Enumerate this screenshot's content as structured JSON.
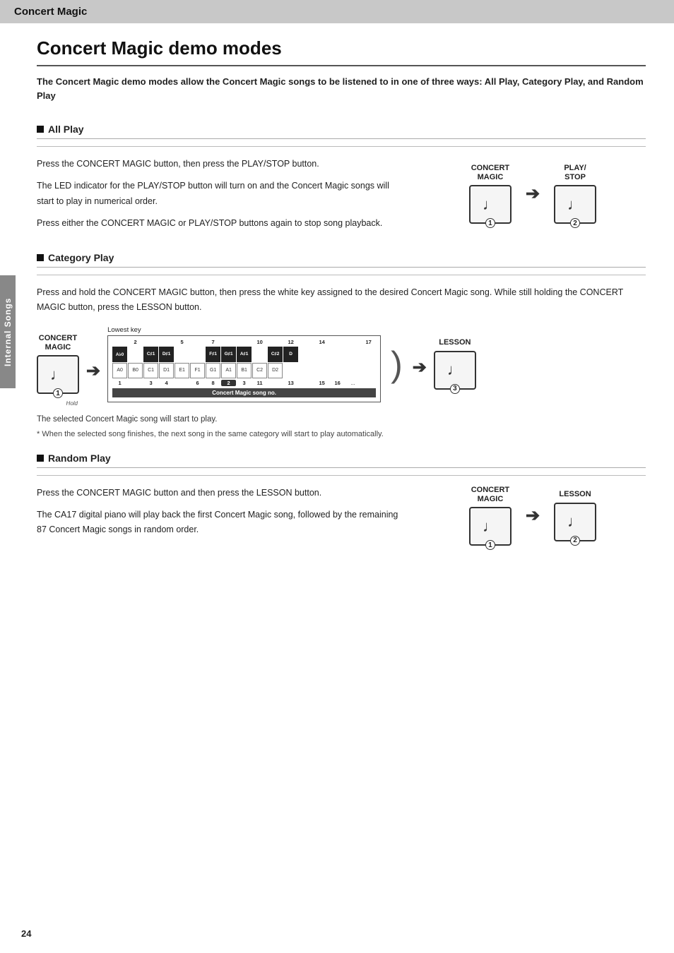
{
  "header": {
    "title": "Concert Magic"
  },
  "sidebar": {
    "label": "Internal Songs"
  },
  "page": {
    "title": "Concert Magic demo modes",
    "intro": "The Concert Magic demo modes allow the Concert Magic songs to be listened to in one of three ways:\nAll Play, Category Play, and Random Play"
  },
  "all_play": {
    "heading": "All Play",
    "text1": "Press the CONCERT MAGIC button, then press the PLAY/STOP button.",
    "text2": "The LED indicator for the PLAY/STOP button will turn on and the Concert Magic songs will start to play in numerical order.",
    "text3": "Press either the CONCERT MAGIC or PLAY/STOP buttons again to stop song playback.",
    "btn1_label": "CONCERT\nMAGIC",
    "btn2_label": "PLAY/\nSTOP",
    "btn1_num": "1",
    "btn2_num": "2"
  },
  "category_play": {
    "heading": "Category Play",
    "text1": "Press and hold the CONCERT MAGIC button, then press the white key assigned to the desired Concert Magic song.\nWhile still holding the CONCERT MAGIC button, press the LESSON button.",
    "btn1_label": "CONCERT\nMAGIC",
    "btn1_num": "1",
    "keyboard_label": "Lowest key",
    "lesson_label": "LESSON",
    "lesson_num": "3",
    "song_label": "Concert Magic song no.",
    "note1": "The selected Concert Magic song will start to play.",
    "note2": "* When the selected song finishes, the next song in the same category will start to play automatically.",
    "black_keys": [
      "A♭0",
      "",
      "C♯1",
      "D♯1",
      "",
      "",
      "F♯1",
      "G♯1",
      "A♯1",
      "",
      "C♯2",
      "D"
    ],
    "white_keys": [
      "A0",
      "B0",
      "C1",
      "D1",
      "E1",
      "F1",
      "G1",
      "A1",
      "B1",
      "C2",
      "D2"
    ],
    "top_numbers": [
      "",
      "2",
      "",
      "",
      "5",
      "",
      "7",
      "",
      "",
      "",
      "10",
      "",
      "12",
      "",
      "14",
      "",
      "",
      "",
      "17"
    ],
    "bottom_numbers": [
      "1",
      "",
      "3",
      "4",
      "",
      "6",
      "8",
      "2",
      "3",
      "11",
      "",
      "13",
      "",
      "15",
      "16",
      "",
      "..."
    ]
  },
  "random_play": {
    "heading": "Random Play",
    "text1": "Press the CONCERT MAGIC button and then press the LESSON button.",
    "text2": "The CA17 digital piano will play back the first Concert Magic song, followed by the remaining 87 Concert Magic songs in random order.",
    "btn1_label": "CONCERT\nMAGIC",
    "btn2_label": "LESSON",
    "btn1_num": "1",
    "btn2_num": "2"
  },
  "page_number": "24"
}
